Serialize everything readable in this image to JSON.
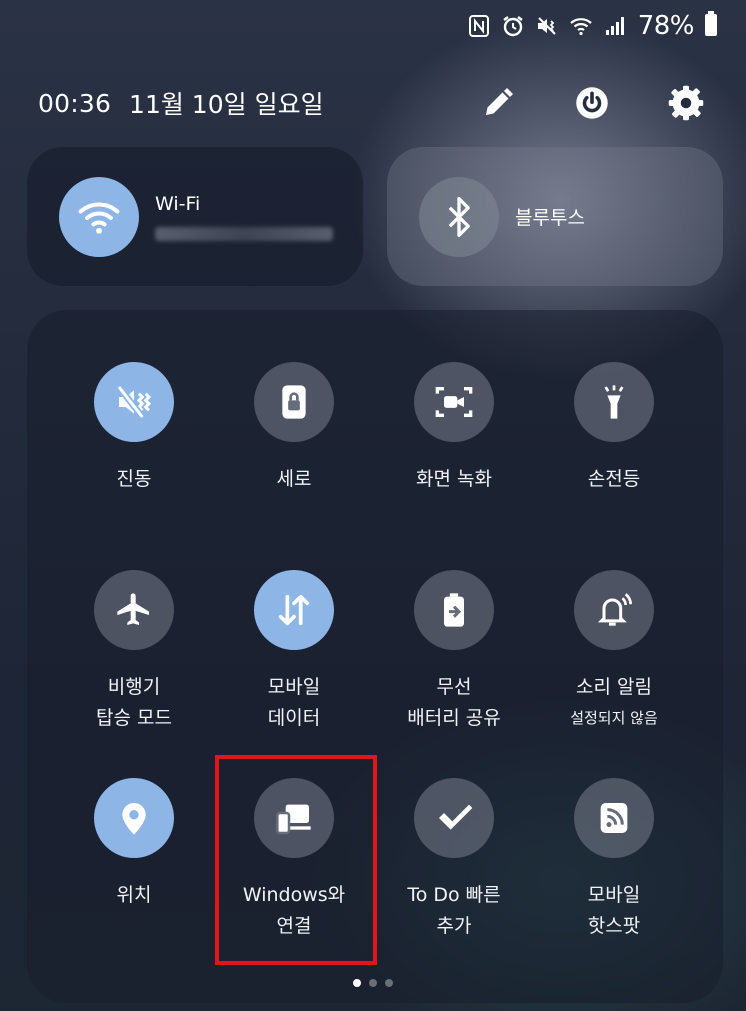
{
  "status_bar": {
    "icons": [
      "nfc-icon",
      "alarm-icon",
      "vibrate-icon",
      "wifi-icon",
      "signal-icon"
    ],
    "battery": "78%"
  },
  "header": {
    "time": "00:36",
    "date": "11월 10일 일요일",
    "actions": [
      "edit-icon",
      "power-icon",
      "settings-icon"
    ]
  },
  "wifi_tile": {
    "label": "Wi-Fi",
    "network": "(blurred network name)",
    "active": true
  },
  "bluetooth_tile": {
    "label": "블루투스",
    "active": false
  },
  "quick_settings": [
    {
      "label_lines": [
        "진동"
      ],
      "icon": "vibrate-icon",
      "active": true
    },
    {
      "label_lines": [
        "세로"
      ],
      "icon": "portrait-lock-icon",
      "active": false
    },
    {
      "label_lines": [
        "화면 녹화"
      ],
      "icon": "screen-record-icon",
      "active": false
    },
    {
      "label_lines": [
        "손전등"
      ],
      "icon": "flashlight-icon",
      "active": false
    },
    {
      "label_lines": [
        "비행기",
        "탑승 모드"
      ],
      "icon": "airplane-icon",
      "active": false
    },
    {
      "label_lines": [
        "모바일",
        "데이터"
      ],
      "icon": "mobile-data-icon",
      "active": true
    },
    {
      "label_lines": [
        "무선",
        "배터리 공유"
      ],
      "icon": "battery-share-icon",
      "active": false
    },
    {
      "label_lines": [
        "소리 알림",
        "설정되지 않음"
      ],
      "icon": "sound-alert-icon",
      "active": false
    },
    {
      "label_lines": [
        "위치"
      ],
      "icon": "location-icon",
      "active": true
    },
    {
      "label_lines": [
        "Windows와",
        "연결"
      ],
      "icon": "link-windows-icon",
      "active": false
    },
    {
      "label_lines": [
        "To Do 빠른",
        "추가"
      ],
      "icon": "todo-icon",
      "active": false
    },
    {
      "label_lines": [
        "모바일",
        "핫스팟"
      ],
      "icon": "hotspot-icon",
      "active": false
    }
  ],
  "highlighted_tile": "Windows와 연결",
  "pager": {
    "pages": 3,
    "current": 1
  },
  "colors": {
    "active": "#8db6e6",
    "highlight": "#e2151b"
  }
}
